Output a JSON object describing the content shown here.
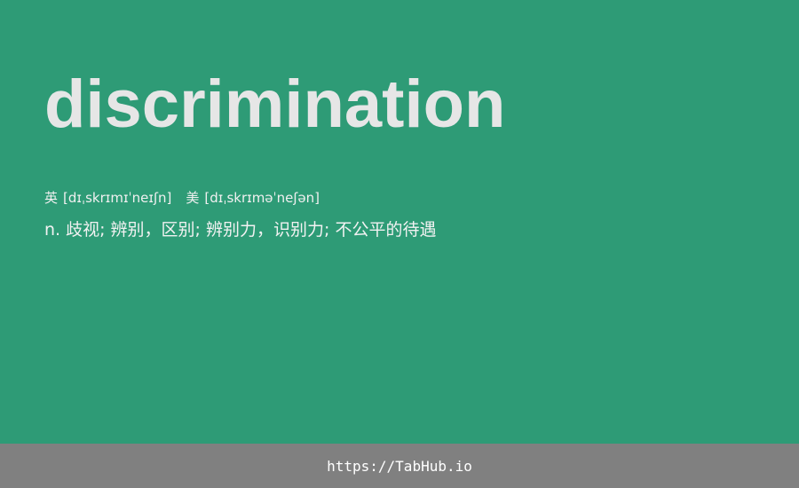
{
  "entry": {
    "word": "discrimination",
    "phonetics": {
      "uk_label": "英",
      "uk": "[dɪˌskrɪmɪˈneɪʃn]",
      "us_label": "美",
      "us": "[dɪˌskrɪməˈneʃən]"
    },
    "definition": "n. 歧视; 辨别，区别; 辨别力，识别力; 不公平的待遇"
  },
  "footer": {
    "link_text": "https://TabHub.io"
  },
  "colors": {
    "background": "#2e9b76",
    "footer_background": "#808080",
    "word_text": "#e6e6e6"
  }
}
